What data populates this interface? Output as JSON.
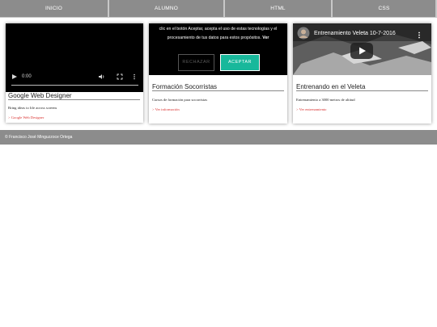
{
  "nav": {
    "items": [
      "INICIO",
      "ALUMNO",
      "HTML",
      "CSS"
    ]
  },
  "cards": [
    {
      "video": {
        "time": "0:00"
      },
      "title": "Google Web Designer",
      "text": "Bring ideas to life across screens",
      "link": "> Google Web Designer"
    },
    {
      "title": "Formación Socorristas",
      "text": "Cursos de formación para socorristas",
      "link": "> Ver información"
    },
    {
      "video": {
        "title": "Entrenamiento Veleta 10-7-2016"
      },
      "title": "Entrenando en el Veleta",
      "text": "Entrenamiento a 3000 metros de altitud",
      "link": "> Ver entrenamiento"
    }
  ],
  "cookie": {
    "text": "clic en el botón Aceptar, acepta el uso de estas tecnologías y el procesamiento de tus datos para estos propósitos.",
    "more": "Ver",
    "reject": "RECHAZAR",
    "accept": "ACEPTAR"
  },
  "footer": {
    "text": "© Francisco José Minguzzoce Ortega"
  },
  "colors": {
    "nav": "#8c8c8c",
    "accent": "#18b89b",
    "link": "#d9302f"
  }
}
